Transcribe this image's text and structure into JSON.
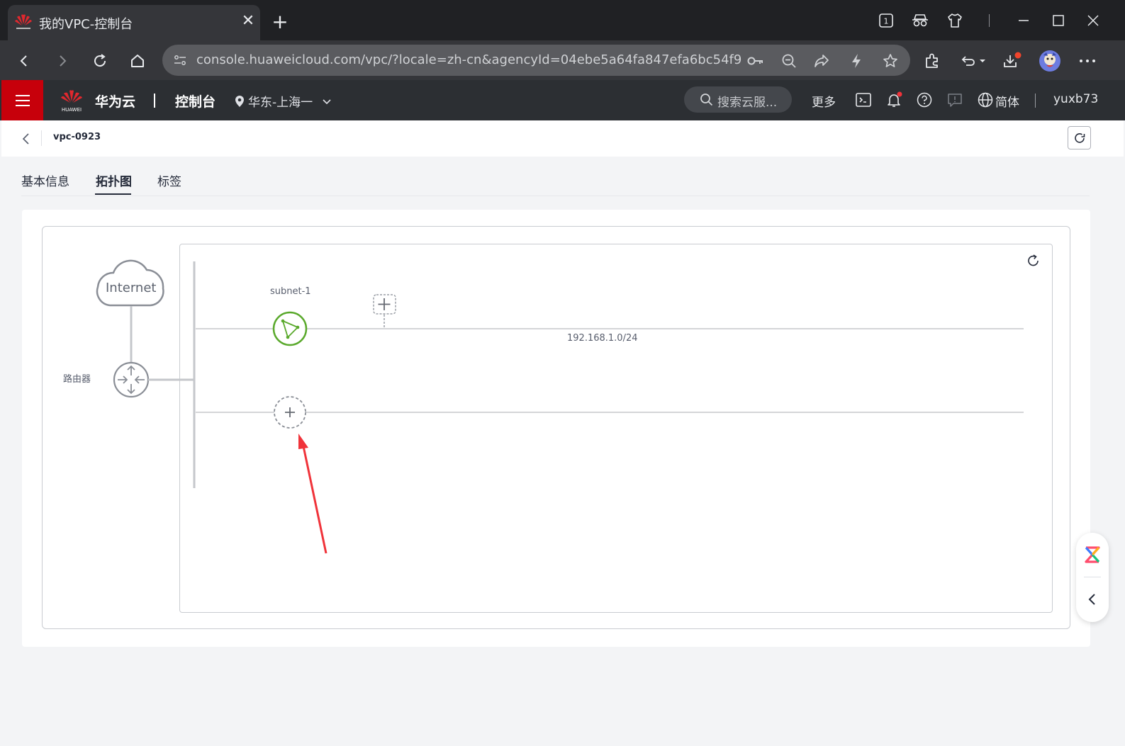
{
  "browser": {
    "tab_title": "我的VPC-控制台",
    "tab_count": "1",
    "url": "console.huaweicloud.com/vpc/?locale=zh-cn&agencyId=04ebe5a64fa847efa6bc54f919..."
  },
  "header": {
    "brand": "华为云",
    "logo_text": "HUAWEI",
    "console": "控制台",
    "region": "华东-上海一",
    "search_placeholder": "搜索云服...",
    "more": "更多",
    "language": "简体",
    "user": "yuxb73"
  },
  "breadcrumb": {
    "current": "vpc-0923"
  },
  "tabs": [
    {
      "label": "基本信息",
      "active": false
    },
    {
      "label": "拓扑图",
      "active": true
    },
    {
      "label": "标签",
      "active": false
    }
  ],
  "topology": {
    "internet_label": "Internet",
    "router_label": "路由器",
    "subnet_name": "subnet-1",
    "subnet_cidr": "192.168.1.0/24"
  },
  "colors": {
    "brand_red": "#c7000b",
    "subnet_green": "#5aa92c",
    "annotation_red": "#f0333a"
  }
}
